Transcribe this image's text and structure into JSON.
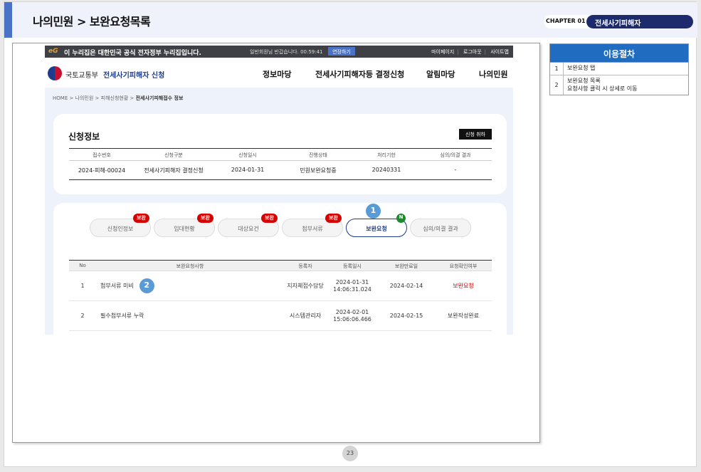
{
  "header": {
    "title": "나의민원 > 보완요청목록",
    "chapter_label": "CHAPTER 01",
    "chapter_name": "전세사기피해자"
  },
  "site": {
    "topbar": {
      "logo": "eG",
      "notice": "이 누리집은 대한민국 공식 전자정부 누리집입니다.",
      "session": "일반회원님 반갑습니다. 00:59:41",
      "extend_label": "연장하기",
      "links": [
        "마이페이지",
        "로그아웃",
        "사이트맵"
      ]
    },
    "nav": {
      "ministry": "국토교통부",
      "service": "전세사기피해자 신청",
      "menu": [
        "정보마당",
        "전세사기피해자등 결정신청",
        "알림마당",
        "나의민원"
      ]
    },
    "breadcrumb": {
      "path": "HOME > 나의민원 > 피해신청현황 >",
      "current": "전세사기피해접수 정보"
    },
    "application": {
      "title": "신청정보",
      "cancel_label": "신청 취하",
      "columns": [
        "접수번호",
        "신청구분",
        "신청일시",
        "진행상태",
        "처리기한",
        "심의/의결 결과"
      ],
      "row": [
        "2024-피해-00024",
        "전세사기피해자 결정신청",
        "2024-01-31",
        "민원보완요청중",
        "20240331",
        "-"
      ]
    },
    "tabs": [
      {
        "label": "신청인정보",
        "badge": "보완"
      },
      {
        "label": "임대현황",
        "badge": "보완"
      },
      {
        "label": "대상요건",
        "badge": "보완"
      },
      {
        "label": "첨부서류",
        "badge": "보완"
      },
      {
        "label": "보완요청",
        "badge": "N"
      },
      {
        "label": "심의/의결 결과",
        "badge": ""
      }
    ],
    "supplement_list": {
      "columns": [
        "No",
        "보완요청사항",
        "등록자",
        "등록일시",
        "보완만료일",
        "요청확인여부"
      ],
      "rows": [
        {
          "no": "1",
          "item": "첨부서류 미비",
          "registrant": "지자체접수담당",
          "reg_date": "2024-01-31",
          "reg_time": "14:06:31.024",
          "deadline": "2024-02-14",
          "status": "보완요청"
        },
        {
          "no": "2",
          "item": "필수첨부서류 누락",
          "registrant": "시스템관리자",
          "reg_date": "2024-02-01",
          "reg_time": "15:06:06.466",
          "deadline": "2024-02-15",
          "status": "보완작성완료"
        }
      ]
    },
    "markers": [
      "1",
      "2"
    ]
  },
  "procedure": {
    "title": "이용절차",
    "steps": [
      {
        "num": "1",
        "text": "보완요청 탭",
        "text2": ""
      },
      {
        "num": "2",
        "text": "보완요청 목록",
        "text2": "요청사항 클릭 시 상세로 이동"
      }
    ]
  },
  "page_number": "23",
  "colors": {
    "accent": "#4a72c7",
    "navy": "#1d2a6b",
    "badge_red": "#d90000",
    "badge_green": "#1d8a2e",
    "procedure_head": "#1f6cc0",
    "marker": "#5b9bd5"
  }
}
